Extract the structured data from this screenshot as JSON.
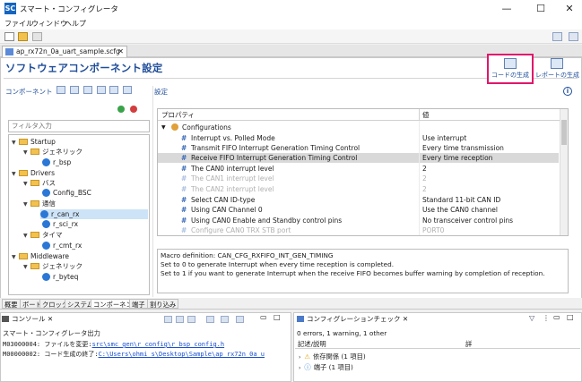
{
  "window": {
    "app_icon": "SC",
    "title": "スマート・コンフィグレータ",
    "minimize": "—",
    "maximize": "☐",
    "close": "✕"
  },
  "menu": [
    "ファイル",
    "ウィンドウ",
    "ヘルプ"
  ],
  "editor_tab": {
    "label": "ap_rx72n_0a_uart_sample.scfg",
    "close": "✕"
  },
  "page": {
    "heading": "ソフトウェアコンポーネント設定"
  },
  "actions": {
    "generate_code": "コードの生成",
    "generate_report": "レポートの生成"
  },
  "components": {
    "header": "コンポーネント",
    "filter_placeholder": "フィルタ入力",
    "tree": [
      {
        "label": "Startup",
        "type": "folder",
        "expanded": true
      },
      {
        "label": "ジェネリック",
        "type": "folder",
        "expanded": true
      },
      {
        "label": "r_bsp",
        "type": "component"
      },
      {
        "label": "Drivers",
        "type": "folder",
        "expanded": true
      },
      {
        "label": "バス",
        "type": "folder",
        "expanded": true
      },
      {
        "label": "Config_BSC",
        "type": "component"
      },
      {
        "label": "通信",
        "type": "folder",
        "expanded": true
      },
      {
        "label": "r_can_rx",
        "type": "component",
        "selected": true
      },
      {
        "label": "r_sci_rx",
        "type": "component"
      },
      {
        "label": "タイマ",
        "type": "folder",
        "expanded": true
      },
      {
        "label": "r_cmt_rx",
        "type": "component"
      },
      {
        "label": "Middleware",
        "type": "folder",
        "expanded": true
      },
      {
        "label": "ジェネリック",
        "type": "folder",
        "expanded": true
      },
      {
        "label": "r_byteq",
        "type": "component"
      }
    ]
  },
  "settings": {
    "label": "設定",
    "info": "i",
    "col_property": "プロパティ",
    "col_value": "値",
    "group": "Configurations",
    "rows": [
      {
        "name": "Interrupt vs. Polled Mode",
        "value": "Use interrupt",
        "enabled": true
      },
      {
        "name": "Transmit FIFO Interrupt Generation Timing Control",
        "value": "Every time transmission",
        "enabled": true
      },
      {
        "name": "Receive FIFO Interrupt Generation Timing Control",
        "value": "Every time reception",
        "enabled": true,
        "highlighted": true
      },
      {
        "name": "The CAN0 interrupt level",
        "value": "2",
        "enabled": true
      },
      {
        "name": "The CAN1 interrupt level",
        "value": "2",
        "enabled": false
      },
      {
        "name": "The CAN2 interrupt level",
        "value": "2",
        "enabled": false
      },
      {
        "name": "Select CAN ID-type",
        "value": "Standard 11-bit CAN ID",
        "enabled": true
      },
      {
        "name": "Using CAN Channel 0",
        "value": "Use the CAN0 channel",
        "enabled": true
      },
      {
        "name": "Using CAN0 Enable and Standby control pins",
        "value": "No transceiver control pins",
        "enabled": true
      },
      {
        "name": "Configure CAN0 TRX STB port",
        "value": "PORT0",
        "enabled": false
      }
    ],
    "description": [
      "Macro definition: CAN_CFG_RXFIFO_INT_GEN_TIMING",
      "Set to 0 to generate Interrupt when every time reception is completed.",
      "Set to 1 if you want to generate Interrupt when the receive FIFO becomes buffer warning by completion of reception."
    ]
  },
  "bottom_tabs": [
    "概要",
    "ボード",
    "クロック",
    "システム",
    "コンポーネント",
    "端子",
    "割り込み"
  ],
  "console": {
    "tab": "コンソール",
    "title": "スマート・コンフィグレータ出力",
    "lines": [
      {
        "prefix": "M03000004: ファイルを変更:",
        "link": "src\\smc_gen\\r_config\\r_bsp_config.h"
      },
      {
        "prefix": "M00000002: コード生成の終了:",
        "link": "C:\\Users\\ohmi s\\Desktop\\Sample\\ap_rx72n_0a_u"
      }
    ]
  },
  "config_check": {
    "tab": "コンフィグレーションチェック",
    "summary": "0 errors, 1 warning, 1 other",
    "col_description": "記述/説明",
    "col_2": "詳",
    "items": [
      {
        "label": "依存関係 (1 項目)",
        "icon": "warning-icon"
      },
      {
        "label": "端子 (1 項目)",
        "icon": "info-icon"
      }
    ]
  }
}
